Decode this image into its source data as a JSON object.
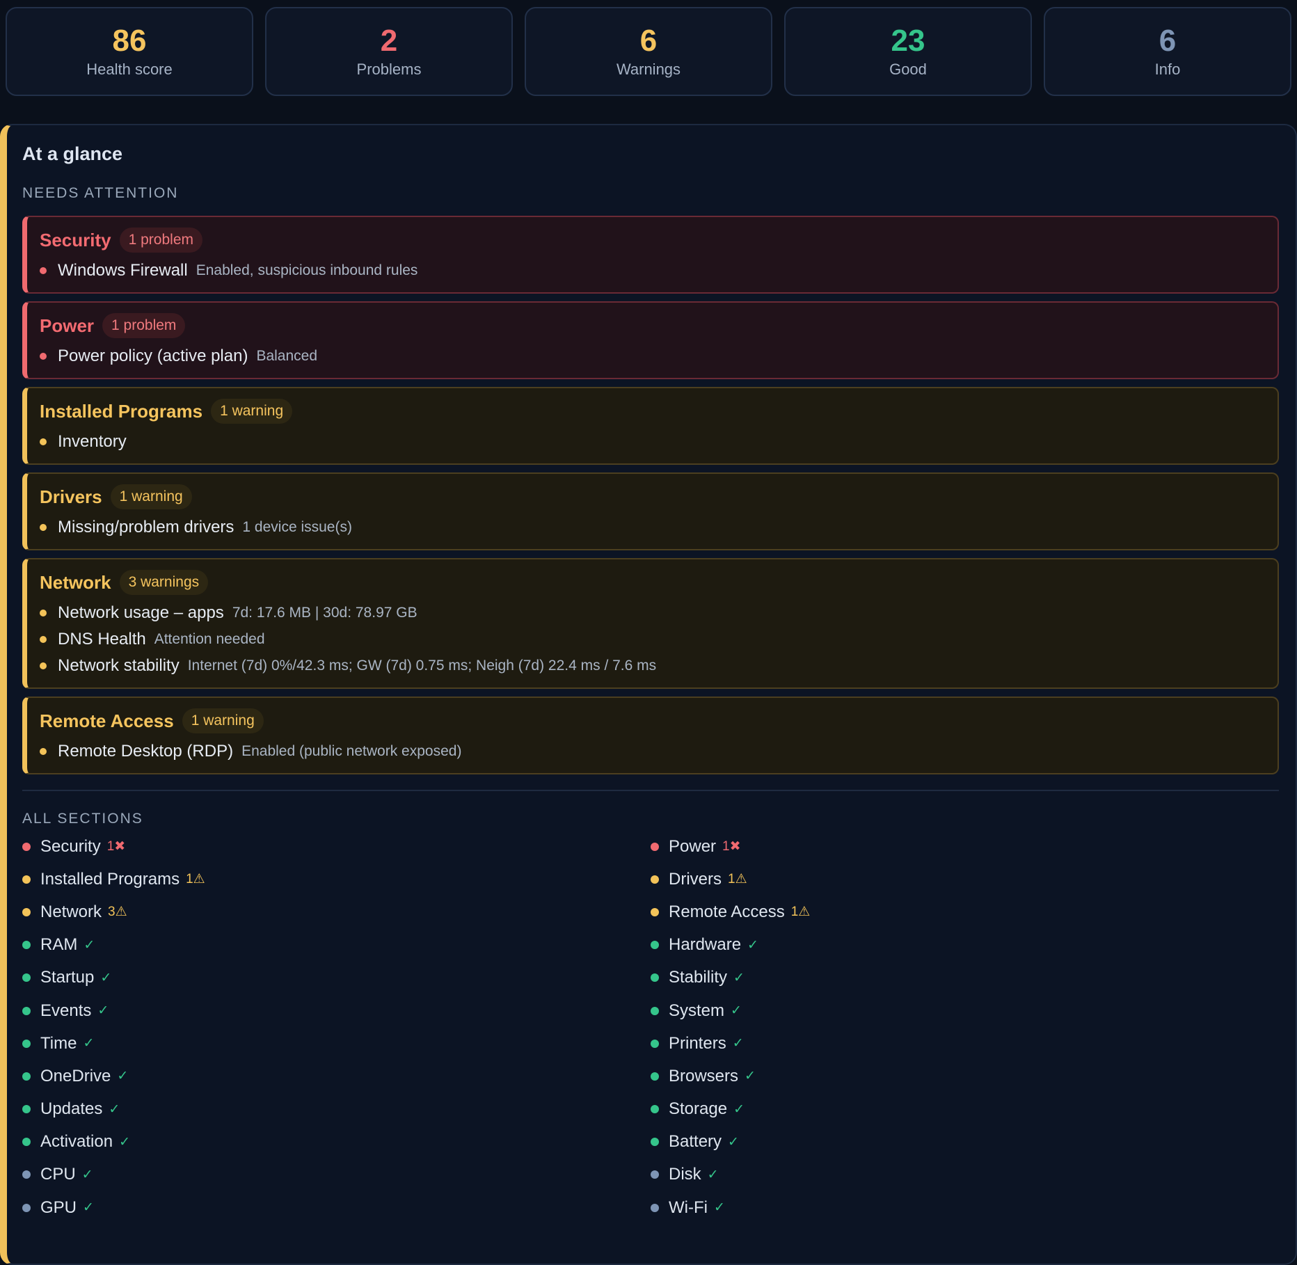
{
  "stats": [
    {
      "value": "86",
      "label": "Health score",
      "color": "#f5c45e"
    },
    {
      "value": "2",
      "label": "Problems",
      "color": "#f06a70"
    },
    {
      "value": "6",
      "label": "Warnings",
      "color": "#f5c45e"
    },
    {
      "value": "23",
      "label": "Good",
      "color": "#35c58b"
    },
    {
      "value": "6",
      "label": "Info",
      "color": "#7e95b5"
    }
  ],
  "panel": {
    "title": "At a glance",
    "needs_attention_label": "NEEDS ATTENTION",
    "all_sections_label": "ALL SECTIONS"
  },
  "attention": [
    {
      "title": "Security",
      "status": "problem",
      "badge": "1 problem",
      "items": [
        {
          "name": "Windows Firewall",
          "detail": "Enabled, suspicious inbound rules"
        }
      ]
    },
    {
      "title": "Power",
      "status": "problem",
      "badge": "1 problem",
      "items": [
        {
          "name": "Power policy (active plan)",
          "detail": "Balanced"
        }
      ]
    },
    {
      "title": "Installed Programs",
      "status": "warning",
      "badge": "1 warning",
      "items": [
        {
          "name": "Inventory",
          "detail": ""
        }
      ]
    },
    {
      "title": "Drivers",
      "status": "warning",
      "badge": "1 warning",
      "items": [
        {
          "name": "Missing/problem drivers",
          "detail": "1 device issue(s)"
        }
      ]
    },
    {
      "title": "Network",
      "status": "warning",
      "badge": "3 warnings",
      "items": [
        {
          "name": "Network usage – apps",
          "detail": "7d: 17.6 MB | 30d: 78.97 GB"
        },
        {
          "name": "DNS Health",
          "detail": "Attention needed"
        },
        {
          "name": "Network stability",
          "detail": "Internet (7d) 0%/42.3 ms; GW (7d) 0.75 ms; Neigh (7d) 22.4 ms / 7.6 ms"
        }
      ]
    },
    {
      "title": "Remote Access",
      "status": "warning",
      "badge": "1 warning",
      "items": [
        {
          "name": "Remote Desktop (RDP)",
          "detail": "Enabled (public network exposed)"
        }
      ]
    }
  ],
  "sections": [
    {
      "name": "Security",
      "status": "problem",
      "badge": "1✖"
    },
    {
      "name": "Power",
      "status": "problem",
      "badge": "1✖"
    },
    {
      "name": "Installed Programs",
      "status": "warning",
      "badge": "1⚠"
    },
    {
      "name": "Drivers",
      "status": "warning",
      "badge": "1⚠"
    },
    {
      "name": "Network",
      "status": "warning",
      "badge": "3⚠"
    },
    {
      "name": "Remote Access",
      "status": "warning",
      "badge": "1⚠"
    },
    {
      "name": "RAM",
      "status": "good",
      "badge": "✓"
    },
    {
      "name": "Hardware",
      "status": "good",
      "badge": "✓"
    },
    {
      "name": "Startup",
      "status": "good",
      "badge": "✓"
    },
    {
      "name": "Stability",
      "status": "good",
      "badge": "✓"
    },
    {
      "name": "Events",
      "status": "good",
      "badge": "✓"
    },
    {
      "name": "System",
      "status": "good",
      "badge": "✓"
    },
    {
      "name": "Time",
      "status": "good",
      "badge": "✓"
    },
    {
      "name": "Printers",
      "status": "good",
      "badge": "✓"
    },
    {
      "name": "OneDrive",
      "status": "good",
      "badge": "✓"
    },
    {
      "name": "Browsers",
      "status": "good",
      "badge": "✓"
    },
    {
      "name": "Updates",
      "status": "good",
      "badge": "✓"
    },
    {
      "name": "Storage",
      "status": "good",
      "badge": "✓"
    },
    {
      "name": "Activation",
      "status": "good",
      "badge": "✓"
    },
    {
      "name": "Battery",
      "status": "good",
      "badge": "✓"
    },
    {
      "name": "CPU",
      "status": "info",
      "badge": "✓"
    },
    {
      "name": "Disk",
      "status": "info",
      "badge": "✓"
    },
    {
      "name": "GPU",
      "status": "info",
      "badge": "✓"
    },
    {
      "name": "Wi-Fi",
      "status": "info",
      "badge": "✓"
    }
  ]
}
